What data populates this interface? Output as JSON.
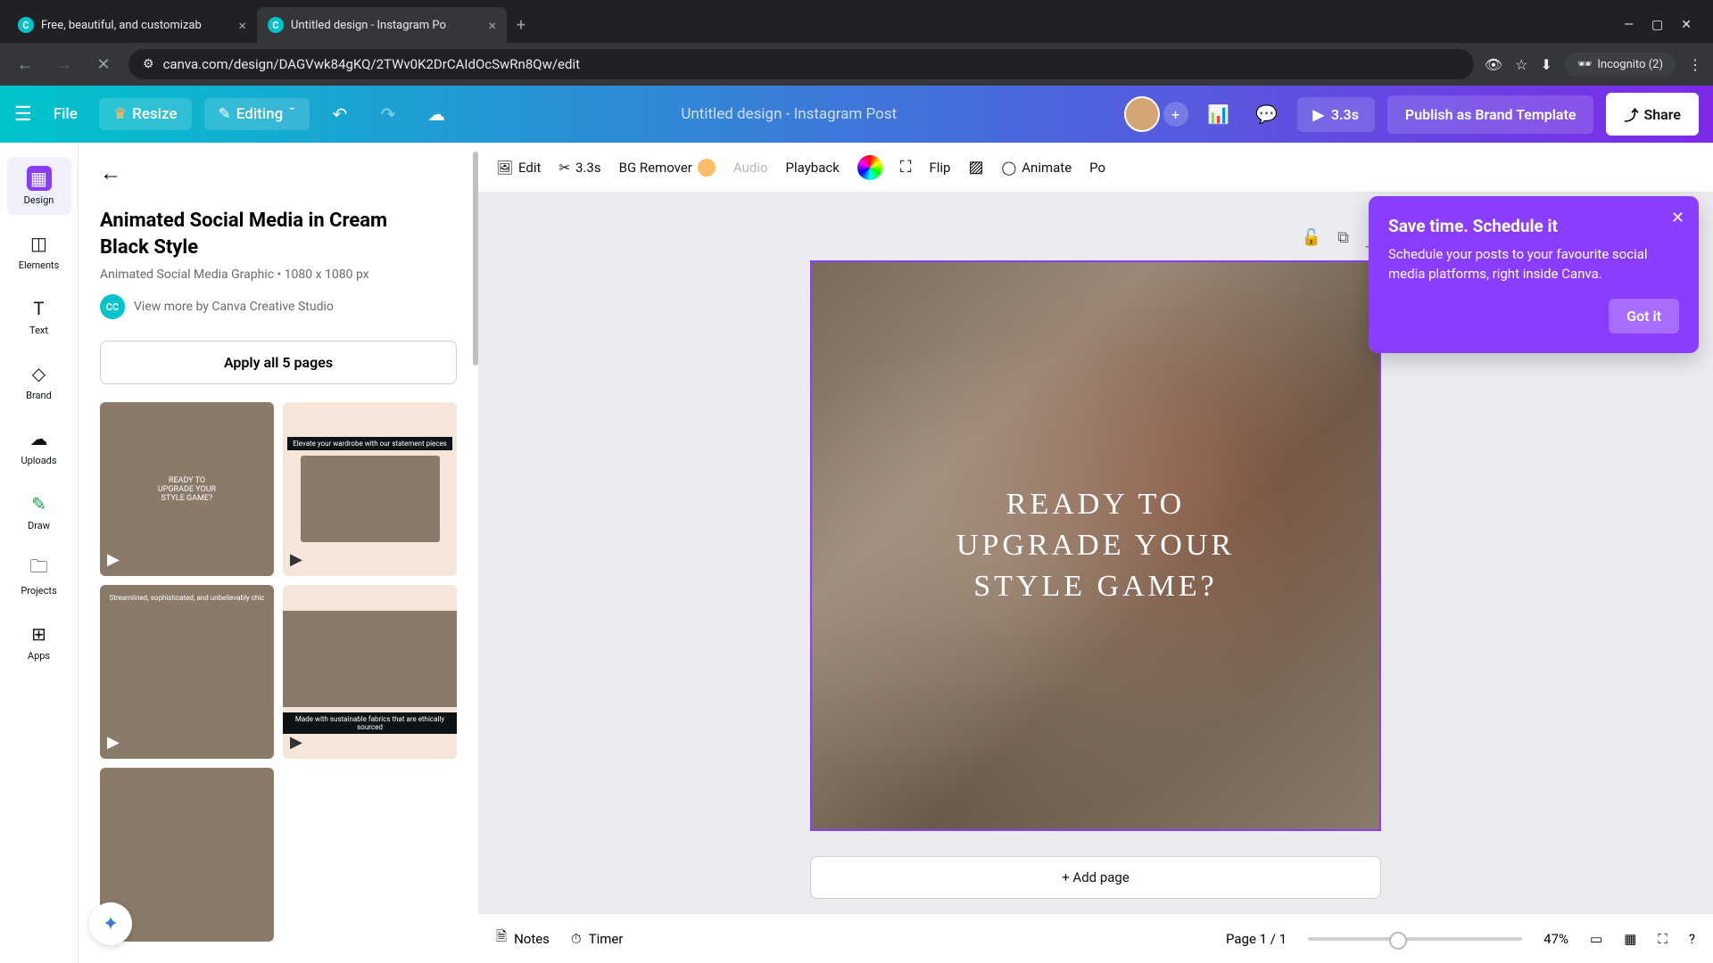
{
  "browser": {
    "tabs": [
      {
        "title": "Free, beautiful, and customizab"
      },
      {
        "title": "Untitled design - Instagram Po"
      }
    ],
    "url": "canva.com/design/DAGVwk84gKQ/2TWv0K2DrCAIdOcSwRn8Qw/edit",
    "incognito": "Incognito (2)"
  },
  "header": {
    "file": "File",
    "resize": "Resize",
    "editing": "Editing",
    "title": "Untitled design - Instagram Post",
    "play_duration": "3.3s",
    "publish": "Publish as Brand Template",
    "share": "Share"
  },
  "rail": {
    "items": [
      "Design",
      "Elements",
      "Text",
      "Brand",
      "Uploads",
      "Draw",
      "Projects",
      "Apps"
    ]
  },
  "panel": {
    "title": "Animated Social Media in Cream Black Style",
    "meta": "Animated Social Media Graphic • 1080 x 1080 px",
    "author": "View more by Canva Creative Studio",
    "author_initials": "CC",
    "apply": "Apply all 5 pages",
    "thumbs": {
      "t1": "READY TO\nUPGRADE YOUR\nSTYLE GAME?",
      "t2": "Elevate your wardrobe with our statement pieces",
      "t3": "Streamlined, sophisticated, and unbelievably chic",
      "t4": "Made with sustainable fabrics that are ethically sourced"
    }
  },
  "context_toolbar": {
    "edit": "Edit",
    "duration": "3.3s",
    "bg_remover": "BG Remover",
    "audio": "Audio",
    "playback": "Playback",
    "flip": "Flip",
    "animate": "Animate",
    "position": "Po"
  },
  "canvas": {
    "text": "READY TO\nUPGRADE YOUR\nSTYLE GAME?",
    "add_page": "+ Add page"
  },
  "tooltip": {
    "title": "Save time. Schedule it",
    "body": "Schedule your posts to your favourite social media platforms, right inside Canva.",
    "cta": "Got it"
  },
  "footer": {
    "notes": "Notes",
    "timer": "Timer",
    "page": "Page 1 / 1",
    "zoom": "47%"
  }
}
